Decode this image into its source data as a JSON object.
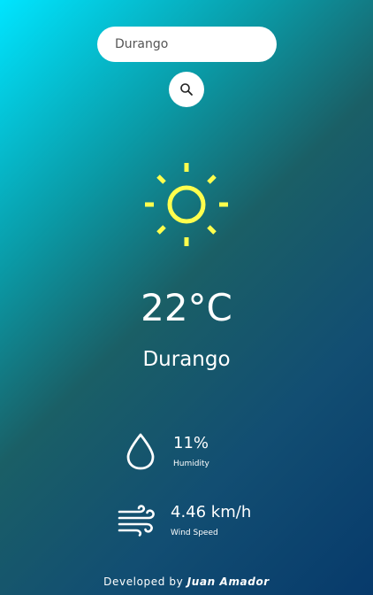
{
  "search": {
    "value": "Durango",
    "button_icon": "search-icon"
  },
  "weather": {
    "condition_icon": "sun-icon",
    "icon_color": "#ffff4d",
    "temperature": "22°C",
    "city": "Durango"
  },
  "details": {
    "humidity": {
      "icon": "water-drop-icon",
      "value": "11%",
      "label": "Humidity"
    },
    "wind": {
      "icon": "wind-icon",
      "value": "4.46 km/h",
      "label": "Wind Speed"
    }
  },
  "footer": {
    "prefix": "Developed by",
    "author": "Juan Amador"
  },
  "colors": {
    "gradient_start": "#00e5ff",
    "gradient_end": "#073a6b"
  }
}
